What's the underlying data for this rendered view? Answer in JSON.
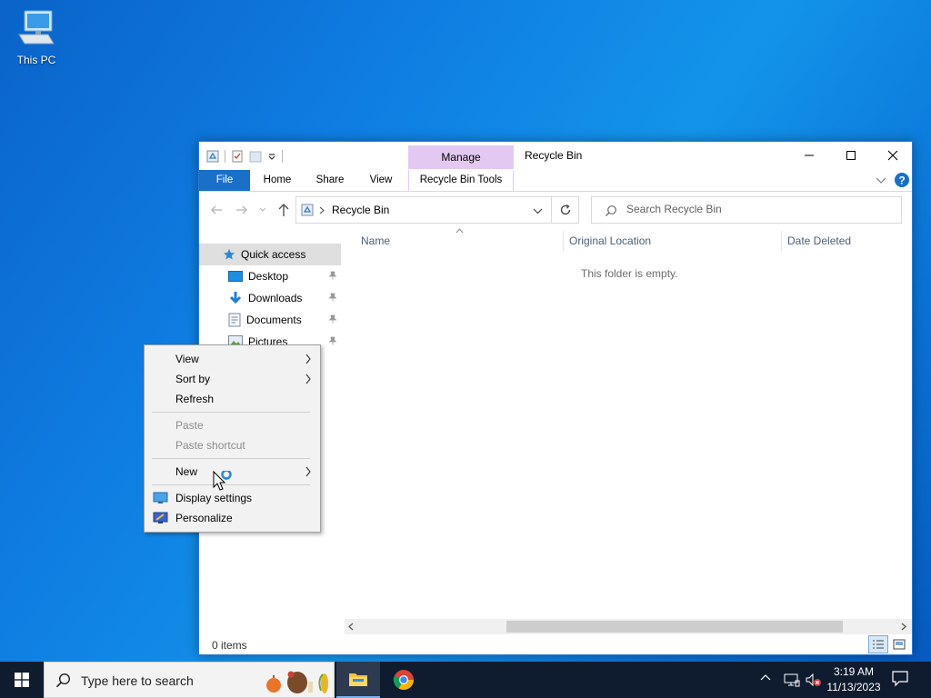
{
  "desktop": {
    "icons": [
      {
        "label": "This PC",
        "icon": "this-pc-icon"
      }
    ]
  },
  "window": {
    "title": "Recycle Bin",
    "contextual_group": "Manage",
    "tabs": [
      "File",
      "Home",
      "Share",
      "View",
      "Recycle Bin Tools"
    ],
    "address": {
      "path": "Recycle Bin"
    },
    "search": {
      "placeholder": "Search Recycle Bin"
    },
    "nav": [
      {
        "label": "Quick access",
        "icon": "star-icon",
        "pinned": false,
        "selected": true
      },
      {
        "label": "Desktop",
        "icon": "desktop-folder-icon",
        "pinned": true
      },
      {
        "label": "Downloads",
        "icon": "download-arrow-icon",
        "pinned": true
      },
      {
        "label": "Documents",
        "icon": "documents-icon",
        "pinned": true
      },
      {
        "label": "Pictures",
        "icon": "pictures-icon",
        "pinned": true
      }
    ],
    "columns": [
      "Name",
      "Original Location",
      "Date Deleted"
    ],
    "empty_message": "This folder is empty.",
    "status": "0 items"
  },
  "context_menu": {
    "items": [
      {
        "label": "View",
        "submenu": true,
        "enabled": true
      },
      {
        "label": "Sort by",
        "submenu": true,
        "enabled": true
      },
      {
        "label": "Refresh",
        "submenu": false,
        "enabled": true
      },
      {
        "label": "Paste",
        "submenu": false,
        "enabled": false
      },
      {
        "label": "Paste shortcut",
        "submenu": false,
        "enabled": false
      },
      {
        "label": "New",
        "submenu": true,
        "enabled": true
      },
      {
        "label": "Display settings",
        "submenu": false,
        "enabled": true,
        "icon": "display-icon"
      },
      {
        "label": "Personalize",
        "submenu": false,
        "enabled": true,
        "icon": "personalize-icon"
      }
    ]
  },
  "taskbar": {
    "search_placeholder": "Type here to search",
    "time": "3:19 AM",
    "date": "11/13/2023"
  },
  "colors": {
    "accent": "#1a6fc9",
    "manage_band": "#e3c9f2",
    "taskbar": "#0f1b2e"
  }
}
